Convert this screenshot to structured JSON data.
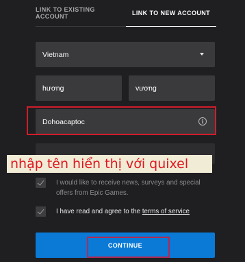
{
  "tabs": {
    "existing": "LINK TO EXISTING ACCOUNT",
    "new": "LINK TO NEW ACCOUNT"
  },
  "form": {
    "country": "Vietnam",
    "first_name": "hương",
    "last_name": "vương",
    "display_name": "Dohoacaptoc",
    "info_icon_glyph": "i",
    "email": ""
  },
  "annotation": "nhập tên hiển thị với quixel",
  "checkboxes": {
    "news": "I would like to receive news, surveys and special offers from Epic Games.",
    "terms_prefix": "I have read and agree to the ",
    "terms_link": "terms of service"
  },
  "continue_label": "CONTINUE",
  "colors": {
    "background": "#1f1f22",
    "field": "#3a3a3d",
    "accent": "#0a7ad6",
    "highlight_red": "#d21c2a"
  },
  "icons": [
    "chevron-down-icon",
    "info-icon",
    "checkmark-icon"
  ]
}
